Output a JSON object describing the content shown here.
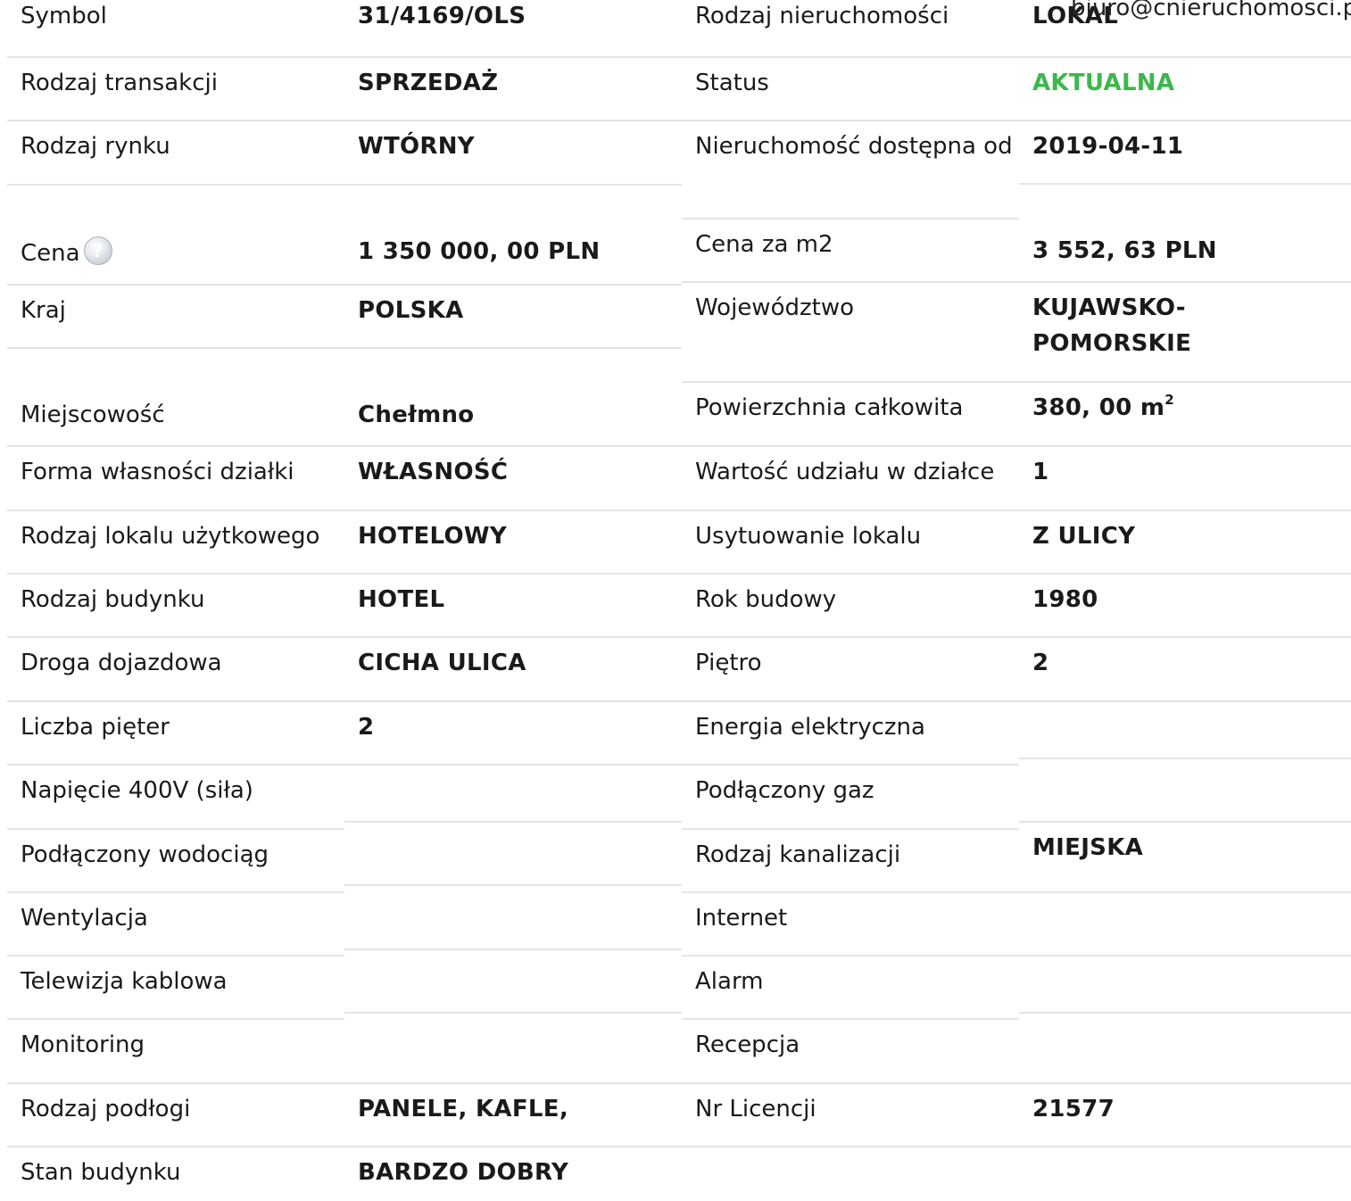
{
  "contact": {
    "email": "biuro@cnieruchomosci.p"
  },
  "left_rows": [
    {
      "label": "Symbol",
      "value": "31/4169/OLS"
    },
    {
      "label": "Rodzaj transakcji",
      "value": "SPRZEDAŻ"
    },
    {
      "label": "Rodzaj rynku",
      "value": "WTÓRNY"
    },
    {
      "label": "Cena",
      "value": "1 350 000, 00 PLN",
      "help_icon": "question-icon"
    },
    {
      "label": "Kraj",
      "value": "POLSKA"
    },
    {
      "label": "Miejscowość",
      "value": "Chełmno"
    },
    {
      "label": "Forma własności działki",
      "value": "WŁASNOŚĆ"
    },
    {
      "label": "Rodzaj lokalu użytkowego",
      "value": "HOTELOWY"
    },
    {
      "label": "Rodzaj budynku",
      "value": "HOTEL"
    },
    {
      "label": "Droga dojazdowa",
      "value": "CICHA ULICA"
    },
    {
      "label": "Liczba pięter",
      "value": "2"
    },
    {
      "label": "Napięcie 400V (siła)",
      "value": ""
    },
    {
      "label": "Podłączony wodociąg",
      "value": ""
    },
    {
      "label": "Wentylacja",
      "value": ""
    },
    {
      "label": "Telewizja kablowa",
      "value": ""
    },
    {
      "label": "Monitoring",
      "value": ""
    },
    {
      "label": "Rodzaj podłogi",
      "value": "PANELE, KAFLE,"
    },
    {
      "label": "Stan budynku",
      "value": "BARDZO DOBRY"
    }
  ],
  "right_rows": [
    {
      "label": "Rodzaj nieruchomości",
      "value": "LOKAL"
    },
    {
      "label": "Status",
      "value": "AKTUALNA",
      "value_color": "#3cb84a"
    },
    {
      "label": "Nieruchomość dostępna od",
      "value": "2019-04-11"
    },
    {
      "label": "Cena za m2",
      "value": "3 552, 63 PLN"
    },
    {
      "label": "Województwo",
      "value": "KUJAWSKO-POMORSKIE"
    },
    {
      "label": "Powierzchnia całkowita",
      "value": "380, 00 m",
      "value_sup": "2"
    },
    {
      "label": "Wartość udziału w działce",
      "value": "1"
    },
    {
      "label": "Usytuowanie lokalu",
      "value": "Z ULICY"
    },
    {
      "label": "Rok budowy",
      "value": "1980"
    },
    {
      "label": "Piętro",
      "value": "2"
    },
    {
      "label": "Energia elektryczna",
      "value": ""
    },
    {
      "label": "Podłączony gaz",
      "value": ""
    },
    {
      "label": "Rodzaj kanalizacji",
      "value": "MIEJSKA"
    },
    {
      "label": "Internet",
      "value": ""
    },
    {
      "label": "Alarm",
      "value": ""
    },
    {
      "label": "Recepcja",
      "value": ""
    },
    {
      "label": "Nr Licencji",
      "value": "21577"
    }
  ],
  "colors": {
    "status_green": "#3cb84a",
    "divider": "#e4e4e4"
  }
}
